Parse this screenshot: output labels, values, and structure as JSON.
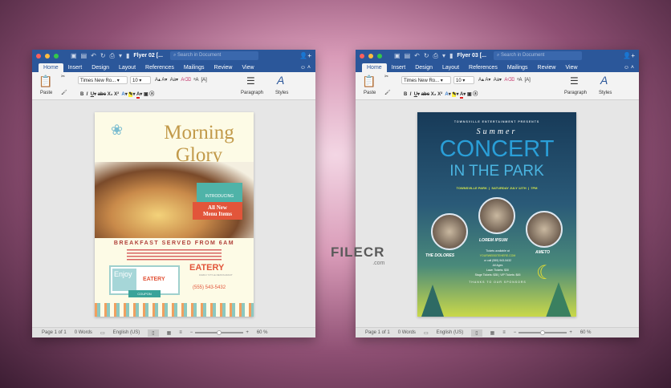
{
  "windows": [
    {
      "title": "Flyer 02 [...",
      "search_placeholder": "Search in Document",
      "tabs": [
        "Home",
        "Insert",
        "Design",
        "Layout",
        "References",
        "Mailings",
        "Review",
        "View"
      ],
      "font": "Times New Ro...",
      "size": "10",
      "paste": "Paste",
      "paragraph": "Paragraph",
      "styles": "Styles",
      "status": {
        "page": "Page 1 of 1",
        "words": "0 Words",
        "language": "English (US)",
        "zoom": "60 %"
      },
      "zoom_fraction": 0.45
    },
    {
      "title": "Flyer 03 [...",
      "search_placeholder": "Search in Document",
      "tabs": [
        "Home",
        "Insert",
        "Design",
        "Layout",
        "References",
        "Mailings",
        "Review",
        "View"
      ],
      "font": "Times New Ro...",
      "size": "10",
      "paste": "Paste",
      "paragraph": "Paragraph",
      "styles": "Styles",
      "status": {
        "page": "Page 1 of 1",
        "words": "0 Words",
        "language": "English (US)",
        "zoom": "60 %"
      },
      "zoom_fraction": 0.45
    }
  ],
  "flyer1": {
    "title1": "Morning",
    "title2": "Glory",
    "introducing": "INTRODUCING",
    "new1": "All New",
    "new2": "Menu Items",
    "headline": "BREAKFAST SERVED FROM 6AM",
    "enjoy": "Enjoy",
    "eatery": "EATERY",
    "eatery_sub": "FAMILY STYLE RESTAURANT",
    "phone": "(555) 543-5432",
    "coupon": "COUPON"
  },
  "flyer2": {
    "presents": "TOWNSVILLE ENTERTAINMENT PRESENTS",
    "summer": "Summer",
    "concert": "CONCERT",
    "park": "IN THE PARK",
    "info": "TOWNSVILLE PARK  |  SATURDAY JULY 12TH  |  7PM",
    "bands": [
      "THE DOLORES",
      "LOREM IPSUM",
      "AMETO"
    ],
    "tickets": "Tickets available at",
    "site": "YOURWEBSITEHERE.COM",
    "call": "or call (555) 543-5432",
    "ages": "All Ages",
    "lawn": "Lawn Tickets: $30",
    "stage": "Stage Tickets: $35 | VIP Tickets: $45",
    "thanks": "THANKS TO OUR SPONSORS"
  },
  "watermark": {
    "name": "FILECR",
    "domain": ".com"
  }
}
